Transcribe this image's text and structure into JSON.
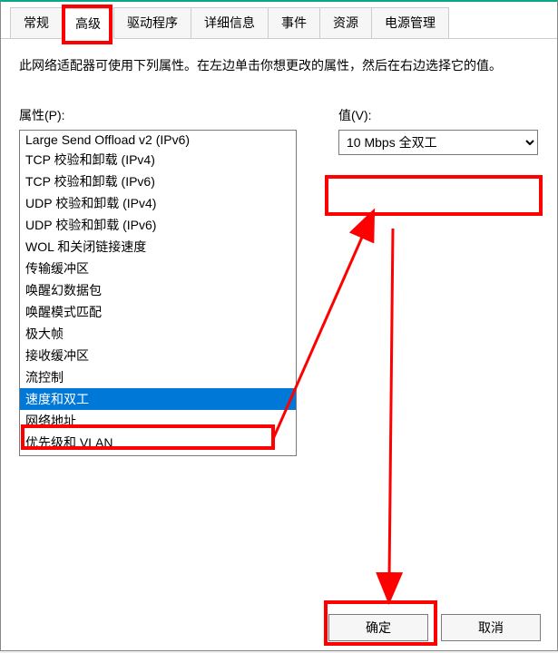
{
  "tabs": {
    "general": "常规",
    "advanced": "高级",
    "driver": "驱动程序",
    "details": "详细信息",
    "events": "事件",
    "resources": "资源",
    "power": "电源管理"
  },
  "description": "此网络适配器可使用下列属性。在左边单击你想更改的属性，然后在右边选择它的值。",
  "property_label": "属性(P):",
  "value_label": "值(V):",
  "properties": [
    "Large Send Offload v2 (IPv6)",
    "TCP 校验和卸载 (IPv4)",
    "TCP 校验和卸载 (IPv6)",
    "UDP 校验和卸载 (IPv4)",
    "UDP 校验和卸载 (IPv6)",
    "WOL 和关闭链接速度",
    "传输缓冲区",
    "唤醒幻数据包",
    "唤醒模式匹配",
    "极大帧",
    "接收缓冲区",
    "流控制",
    "速度和双工",
    "网络地址",
    "优先级和 VLAN"
  ],
  "selected_property_index": 12,
  "value_selected": "10 Mbps 全双工",
  "buttons": {
    "ok": "确定",
    "cancel": "取消"
  }
}
